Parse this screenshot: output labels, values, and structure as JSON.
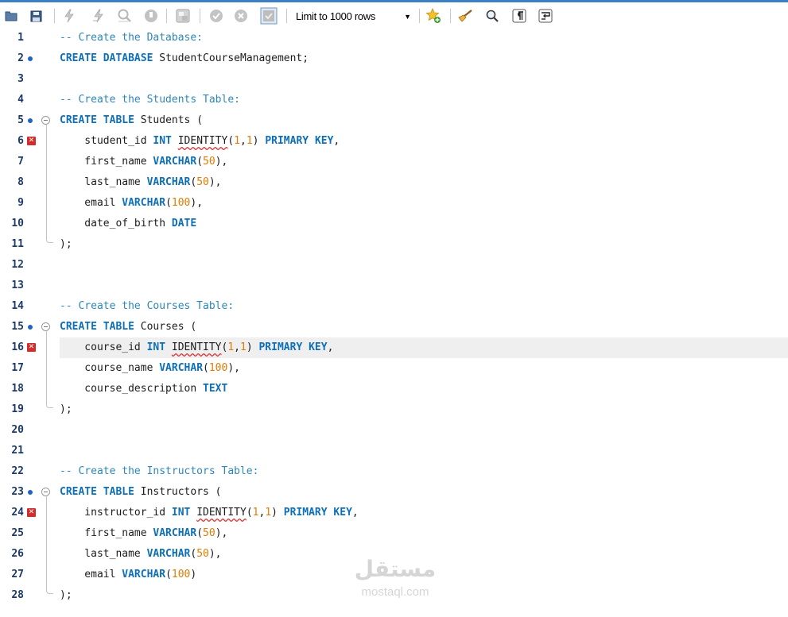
{
  "toolbar": {
    "limit_label": "Limit to 1000 rows",
    "icons": [
      "folder-open-icon",
      "save-icon",
      "execute-icon",
      "execute-current-icon",
      "explain-icon",
      "stop-icon",
      "toggle-results-icon",
      "commit-icon",
      "rollback-icon",
      "autocommit-icon",
      "limit-select",
      "add-snippet-icon",
      "beautify-icon",
      "find-icon",
      "invisible-chars-icon",
      "wrap-icon"
    ]
  },
  "editor": {
    "lines": [
      {
        "n": "1",
        "marker": "",
        "fold": "",
        "text": "-- Create the Database:"
      },
      {
        "n": "2",
        "marker": "dot",
        "fold": "",
        "text": "CREATE DATABASE StudentCourseManagement;"
      },
      {
        "n": "3",
        "marker": "",
        "fold": "",
        "text": ""
      },
      {
        "n": "4",
        "marker": "",
        "fold": "",
        "text": "-- Create the Students Table:"
      },
      {
        "n": "5",
        "marker": "dot",
        "fold": "start",
        "text": "CREATE TABLE Students ("
      },
      {
        "n": "6",
        "marker": "error",
        "fold": "mid",
        "text": "    student_id INT IDENTITY(1,1) PRIMARY KEY,"
      },
      {
        "n": "7",
        "marker": "",
        "fold": "mid",
        "text": "    first_name VARCHAR(50),"
      },
      {
        "n": "8",
        "marker": "",
        "fold": "mid",
        "text": "    last_name VARCHAR(50),"
      },
      {
        "n": "9",
        "marker": "",
        "fold": "mid",
        "text": "    email VARCHAR(100),"
      },
      {
        "n": "10",
        "marker": "",
        "fold": "mid",
        "text": "    date_of_birth DATE"
      },
      {
        "n": "11",
        "marker": "",
        "fold": "end",
        "text": ");"
      },
      {
        "n": "12",
        "marker": "",
        "fold": "",
        "text": ""
      },
      {
        "n": "13",
        "marker": "",
        "fold": "",
        "text": ""
      },
      {
        "n": "14",
        "marker": "",
        "fold": "",
        "text": "-- Create the Courses Table:"
      },
      {
        "n": "15",
        "marker": "dot",
        "fold": "start",
        "text": "CREATE TABLE Courses ("
      },
      {
        "n": "16",
        "marker": "error",
        "fold": "mid",
        "text": "    course_id INT IDENTITY(1,1) PRIMARY KEY,",
        "current": true
      },
      {
        "n": "17",
        "marker": "",
        "fold": "mid",
        "text": "    course_name VARCHAR(100),"
      },
      {
        "n": "18",
        "marker": "",
        "fold": "mid",
        "text": "    course_description TEXT"
      },
      {
        "n": "19",
        "marker": "",
        "fold": "end",
        "text": ");"
      },
      {
        "n": "20",
        "marker": "",
        "fold": "",
        "text": ""
      },
      {
        "n": "21",
        "marker": "",
        "fold": "",
        "text": ""
      },
      {
        "n": "22",
        "marker": "",
        "fold": "",
        "text": "-- Create the Instructors Table:"
      },
      {
        "n": "23",
        "marker": "dot",
        "fold": "start",
        "text": "CREATE TABLE Instructors ("
      },
      {
        "n": "24",
        "marker": "error",
        "fold": "mid",
        "text": "    instructor_id INT IDENTITY(1,1) PRIMARY KEY,"
      },
      {
        "n": "25",
        "marker": "",
        "fold": "mid",
        "text": "    first_name VARCHAR(50),"
      },
      {
        "n": "26",
        "marker": "",
        "fold": "mid",
        "text": "    last_name VARCHAR(50),"
      },
      {
        "n": "27",
        "marker": "",
        "fold": "mid",
        "text": "    email VARCHAR(100)"
      },
      {
        "n": "28",
        "marker": "",
        "fold": "end",
        "text": ");"
      }
    ]
  },
  "watermark": {
    "arabic": "مستقل",
    "latin": "mostaql.com"
  },
  "colors": {
    "keyword": "#0d6fb8",
    "comment": "#2e86b8",
    "number": "#e07b00",
    "line_number": "#1a3a6b",
    "marker_dot": "#1d63c8",
    "marker_error": "#d52b2b"
  }
}
